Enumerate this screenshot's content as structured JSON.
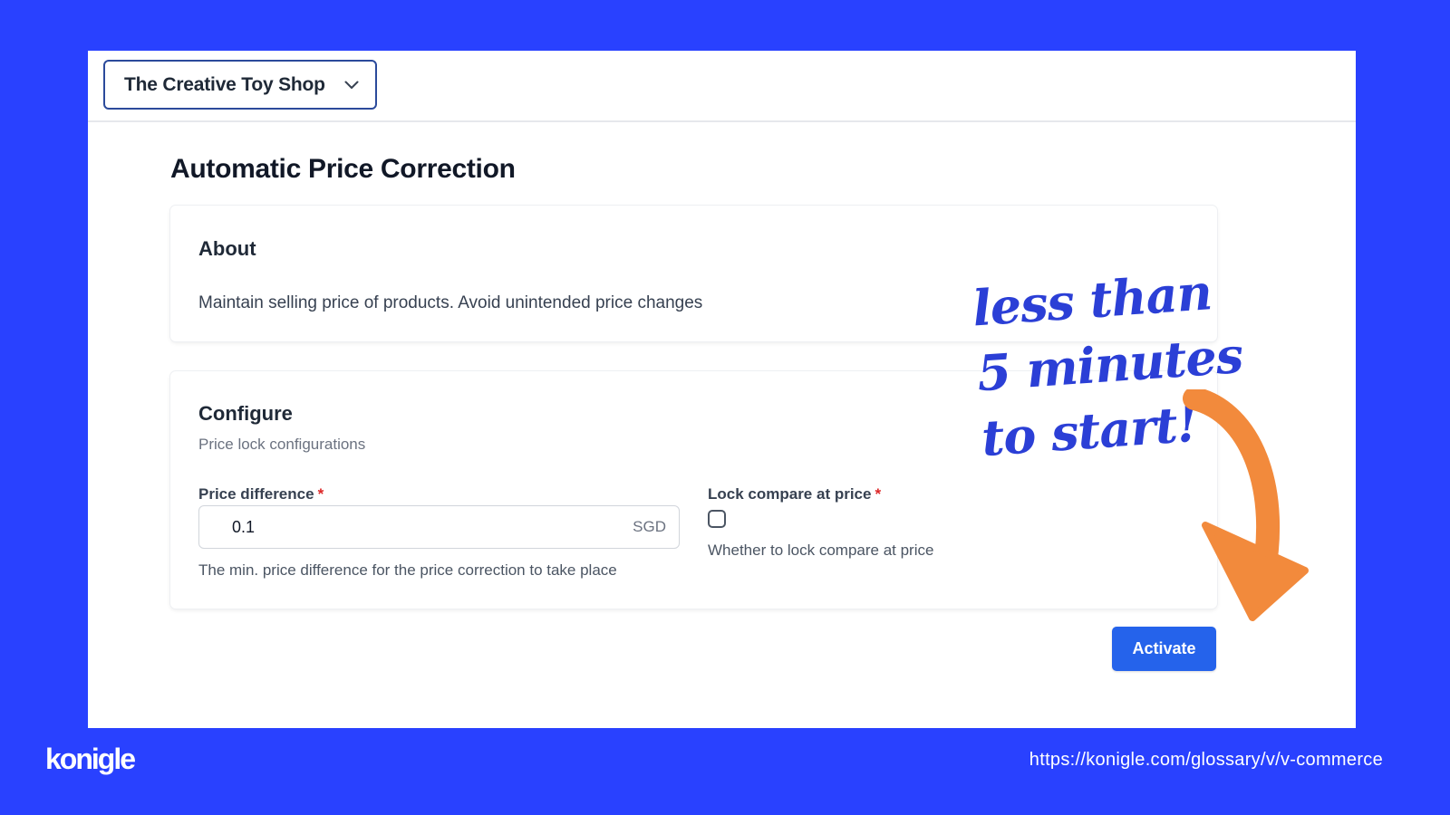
{
  "colors": {
    "background": "#2941ff",
    "primary_button": "#2563eb",
    "required_marker": "#dc2626",
    "annotation_text": "#2b3fd6",
    "annotation_arrow": "#f28a3c"
  },
  "header": {
    "shop_selector": {
      "selected": "The Creative Toy Shop",
      "icon": "chevron-down-icon"
    }
  },
  "main": {
    "page_title": "Automatic Price Correction",
    "about": {
      "title": "About",
      "description": "Maintain selling price of products. Avoid unintended price changes"
    },
    "configure": {
      "title": "Configure",
      "subtitle": "Price lock configurations",
      "price_difference": {
        "label": "Price difference",
        "required_marker": "*",
        "value": "0.1",
        "suffix": "SGD",
        "help": "The min. price difference for the price correction to take place"
      },
      "lock_compare": {
        "label": "Lock compare at price",
        "required_marker": "*",
        "checked": false,
        "help": "Whether to lock compare at price"
      }
    },
    "activate_label": "Activate"
  },
  "annotation": {
    "lines": [
      "less than",
      "5 minutes",
      "to start!"
    ],
    "arrow_icon": "curved-arrow-icon"
  },
  "footer": {
    "brand": "konigle",
    "url": "https://konigle.com/glossary/v/v-commerce"
  }
}
